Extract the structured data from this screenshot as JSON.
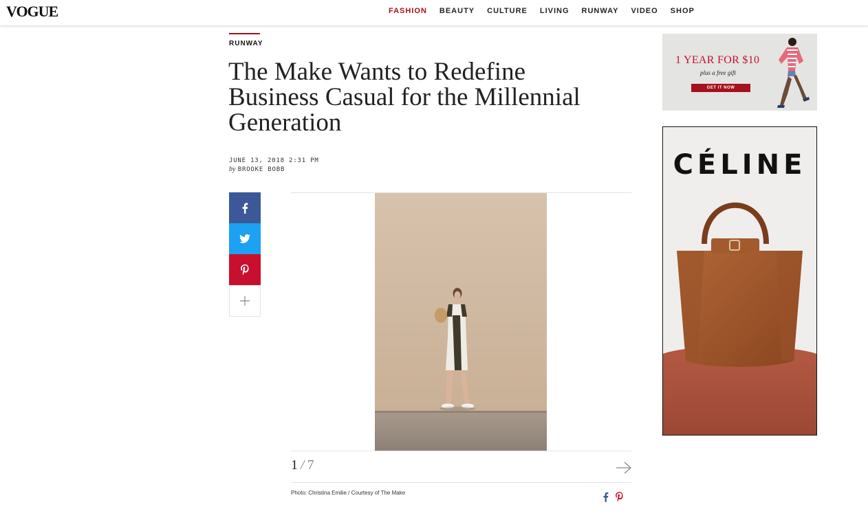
{
  "header": {
    "logo": "VOGUE",
    "nav": [
      "FASHION",
      "BEAUTY",
      "CULTURE",
      "LIVING",
      "RUNWAY",
      "VIDEO",
      "SHOP"
    ],
    "active_nav": "FASHION"
  },
  "article": {
    "section": "RUNWAY",
    "title": "The Make Wants to Redefine Business Casual for the Millennial Generation",
    "date": "JUNE 13, 2018 2:31 PM",
    "by": "by",
    "author": "BROOKE BOBB"
  },
  "share": {
    "icons": [
      "facebook-icon",
      "twitter-icon",
      "pinterest-icon",
      "plus-icon"
    ]
  },
  "gallery": {
    "current": "1",
    "separator": "/",
    "total": "7",
    "credit": "Photo: Christina Emilie / Courtesy of The Make"
  },
  "ads": {
    "ad1": {
      "title": "1 YEAR FOR $10",
      "subtitle": "plus a free gift",
      "button": "GET IT NOW"
    },
    "ad2": {
      "brand": "CÉLINE"
    }
  },
  "colors": {
    "accent": "#a5111c",
    "facebook": "#3b5998",
    "twitter": "#1da1f2",
    "pinterest": "#c8102e"
  }
}
